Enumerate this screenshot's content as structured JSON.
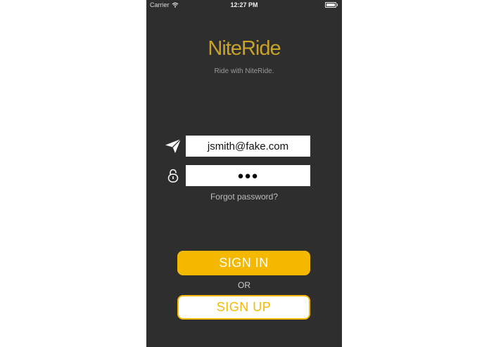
{
  "status_bar": {
    "carrier": "Carrier",
    "time": "12:27 PM",
    "wifi_icon": "wifi-icon",
    "battery_icon": "battery-icon"
  },
  "app": {
    "title": "NiteRide",
    "tagline": "Ride with NiteRide."
  },
  "login": {
    "email_icon": "paper-plane-icon",
    "email_value": "jsmith@fake.com",
    "password_icon": "lock-icon",
    "password_value": "●●●",
    "forgot_label": "Forgot password?"
  },
  "actions": {
    "sign_in_label": "SIGN IN",
    "or_label": "OR",
    "sign_up_label": "SIGN UP"
  },
  "colors": {
    "background": "#2e2e2e",
    "accent": "#f5b800",
    "title": "#c9a227"
  }
}
